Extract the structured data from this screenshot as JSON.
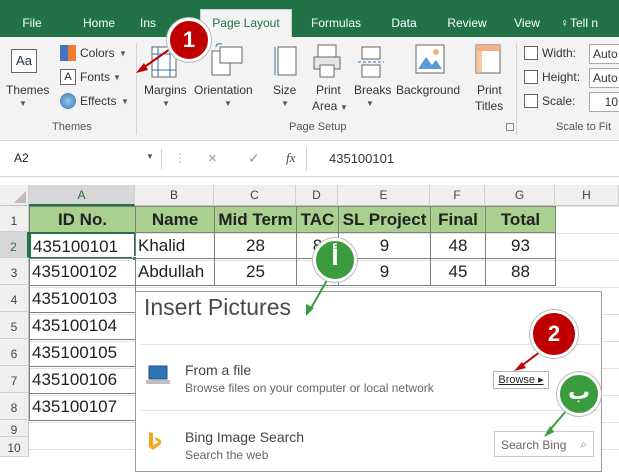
{
  "tabs": [
    "File",
    "Home",
    "Ins",
    "Page Layout",
    "Formulas",
    "Data",
    "Review",
    "View",
    "Tell n"
  ],
  "ribbon": {
    "themes": {
      "themes_label": "Themes",
      "colors_label": "Colors",
      "fonts_label": "Fonts",
      "effects_label": "Effects",
      "group_label": "Themes"
    },
    "page_setup": {
      "margins": "Margins",
      "orientation": "Orientation",
      "size": "Size",
      "print_area_1": "Print",
      "print_area_2": "Area",
      "breaks": "Breaks",
      "background": "Background",
      "print_titles_1": "Print",
      "print_titles_2": "Titles",
      "group_label": "Page Setup"
    },
    "scale": {
      "width_label": "Width:",
      "width_value": "Auto",
      "height_label": "Height:",
      "height_value": "Auto",
      "scale_label": "Scale:",
      "scale_value": "10",
      "group_label": "Scale to Fit"
    }
  },
  "formula_bar": {
    "name_box": "A2",
    "cancel": "×",
    "enter": "✓",
    "fx": "fx",
    "value": "435100101"
  },
  "columns": [
    "A",
    "B",
    "C",
    "D",
    "E",
    "F",
    "G",
    "H"
  ],
  "rows": [
    "1",
    "2",
    "3",
    "4",
    "5",
    "6",
    "7",
    "8",
    "9",
    "10"
  ],
  "table": {
    "headers": [
      "ID No.",
      "Name",
      "Mid Term",
      "TAC",
      "SL Project",
      "Final",
      "Total"
    ],
    "rows": [
      [
        "435100101",
        "Khalid",
        "28",
        "8",
        "9",
        "48",
        "93"
      ],
      [
        "435100102",
        "Abdullah",
        "25",
        "",
        "9",
        "45",
        "88"
      ],
      [
        "435100103"
      ],
      [
        "435100104"
      ],
      [
        "435100105"
      ],
      [
        "435100106"
      ],
      [
        "435100107"
      ]
    ]
  },
  "dialog": {
    "title": "Insert Pictures",
    "from_file": {
      "title": "From a file",
      "subtitle": "Browse files on your computer or local network",
      "button": "Browse ▸"
    },
    "bing": {
      "title": "Bing Image Search",
      "subtitle": "Search the web",
      "placeholder": "Search Bing"
    }
  },
  "callouts": {
    "one": "1",
    "two": "2",
    "alef": "أ",
    "ba": "ب"
  },
  "colors": {
    "excel_green": "#217346",
    "header_fill": "#a9d08e",
    "callout_red": "#c00000",
    "callout_green": "#3a9b3f"
  }
}
